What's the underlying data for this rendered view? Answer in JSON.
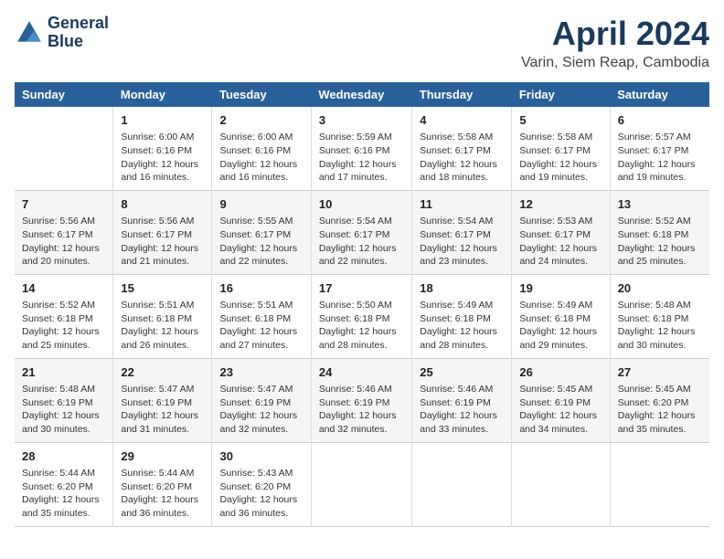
{
  "header": {
    "logo_line1": "General",
    "logo_line2": "Blue",
    "main_title": "April 2024",
    "subtitle": "Varin, Siem Reap, Cambodia"
  },
  "columns": [
    "Sunday",
    "Monday",
    "Tuesday",
    "Wednesday",
    "Thursday",
    "Friday",
    "Saturday"
  ],
  "weeks": [
    [
      {
        "num": "",
        "info": ""
      },
      {
        "num": "1",
        "info": "Sunrise: 6:00 AM\nSunset: 6:16 PM\nDaylight: 12 hours\nand 16 minutes."
      },
      {
        "num": "2",
        "info": "Sunrise: 6:00 AM\nSunset: 6:16 PM\nDaylight: 12 hours\nand 16 minutes."
      },
      {
        "num": "3",
        "info": "Sunrise: 5:59 AM\nSunset: 6:16 PM\nDaylight: 12 hours\nand 17 minutes."
      },
      {
        "num": "4",
        "info": "Sunrise: 5:58 AM\nSunset: 6:17 PM\nDaylight: 12 hours\nand 18 minutes."
      },
      {
        "num": "5",
        "info": "Sunrise: 5:58 AM\nSunset: 6:17 PM\nDaylight: 12 hours\nand 19 minutes."
      },
      {
        "num": "6",
        "info": "Sunrise: 5:57 AM\nSunset: 6:17 PM\nDaylight: 12 hours\nand 19 minutes."
      }
    ],
    [
      {
        "num": "7",
        "info": "Sunrise: 5:56 AM\nSunset: 6:17 PM\nDaylight: 12 hours\nand 20 minutes."
      },
      {
        "num": "8",
        "info": "Sunrise: 5:56 AM\nSunset: 6:17 PM\nDaylight: 12 hours\nand 21 minutes."
      },
      {
        "num": "9",
        "info": "Sunrise: 5:55 AM\nSunset: 6:17 PM\nDaylight: 12 hours\nand 22 minutes."
      },
      {
        "num": "10",
        "info": "Sunrise: 5:54 AM\nSunset: 6:17 PM\nDaylight: 12 hours\nand 22 minutes."
      },
      {
        "num": "11",
        "info": "Sunrise: 5:54 AM\nSunset: 6:17 PM\nDaylight: 12 hours\nand 23 minutes."
      },
      {
        "num": "12",
        "info": "Sunrise: 5:53 AM\nSunset: 6:17 PM\nDaylight: 12 hours\nand 24 minutes."
      },
      {
        "num": "13",
        "info": "Sunrise: 5:52 AM\nSunset: 6:18 PM\nDaylight: 12 hours\nand 25 minutes."
      }
    ],
    [
      {
        "num": "14",
        "info": "Sunrise: 5:52 AM\nSunset: 6:18 PM\nDaylight: 12 hours\nand 25 minutes."
      },
      {
        "num": "15",
        "info": "Sunrise: 5:51 AM\nSunset: 6:18 PM\nDaylight: 12 hours\nand 26 minutes."
      },
      {
        "num": "16",
        "info": "Sunrise: 5:51 AM\nSunset: 6:18 PM\nDaylight: 12 hours\nand 27 minutes."
      },
      {
        "num": "17",
        "info": "Sunrise: 5:50 AM\nSunset: 6:18 PM\nDaylight: 12 hours\nand 28 minutes."
      },
      {
        "num": "18",
        "info": "Sunrise: 5:49 AM\nSunset: 6:18 PM\nDaylight: 12 hours\nand 28 minutes."
      },
      {
        "num": "19",
        "info": "Sunrise: 5:49 AM\nSunset: 6:18 PM\nDaylight: 12 hours\nand 29 minutes."
      },
      {
        "num": "20",
        "info": "Sunrise: 5:48 AM\nSunset: 6:18 PM\nDaylight: 12 hours\nand 30 minutes."
      }
    ],
    [
      {
        "num": "21",
        "info": "Sunrise: 5:48 AM\nSunset: 6:19 PM\nDaylight: 12 hours\nand 30 minutes."
      },
      {
        "num": "22",
        "info": "Sunrise: 5:47 AM\nSunset: 6:19 PM\nDaylight: 12 hours\nand 31 minutes."
      },
      {
        "num": "23",
        "info": "Sunrise: 5:47 AM\nSunset: 6:19 PM\nDaylight: 12 hours\nand 32 minutes."
      },
      {
        "num": "24",
        "info": "Sunrise: 5:46 AM\nSunset: 6:19 PM\nDaylight: 12 hours\nand 32 minutes."
      },
      {
        "num": "25",
        "info": "Sunrise: 5:46 AM\nSunset: 6:19 PM\nDaylight: 12 hours\nand 33 minutes."
      },
      {
        "num": "26",
        "info": "Sunrise: 5:45 AM\nSunset: 6:19 PM\nDaylight: 12 hours\nand 34 minutes."
      },
      {
        "num": "27",
        "info": "Sunrise: 5:45 AM\nSunset: 6:20 PM\nDaylight: 12 hours\nand 35 minutes."
      }
    ],
    [
      {
        "num": "28",
        "info": "Sunrise: 5:44 AM\nSunset: 6:20 PM\nDaylight: 12 hours\nand 35 minutes."
      },
      {
        "num": "29",
        "info": "Sunrise: 5:44 AM\nSunset: 6:20 PM\nDaylight: 12 hours\nand 36 minutes."
      },
      {
        "num": "30",
        "info": "Sunrise: 5:43 AM\nSunset: 6:20 PM\nDaylight: 12 hours\nand 36 minutes."
      },
      {
        "num": "",
        "info": ""
      },
      {
        "num": "",
        "info": ""
      },
      {
        "num": "",
        "info": ""
      },
      {
        "num": "",
        "info": ""
      }
    ]
  ]
}
